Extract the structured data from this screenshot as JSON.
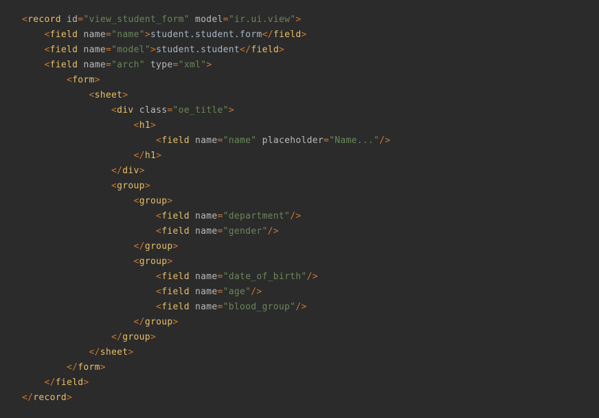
{
  "colors": {
    "bg": "#2b2b2b",
    "punct": "#cc7832",
    "tag": "#e8bf6a",
    "attr": "#bababa",
    "str": "#6a8759",
    "text": "#a9b7c6"
  },
  "indent_unit": 4,
  "tokens": {
    "lt": "<",
    "gt": ">",
    "lt_slash": "</",
    "slash_gt": "/>",
    "eq": "=",
    "q": "\""
  },
  "tags": {
    "record": "record",
    "field": "field",
    "form": "form",
    "sheet": "sheet",
    "div": "div",
    "h1": "h1",
    "group": "group"
  },
  "attrs": {
    "id": "id",
    "model": "model",
    "name": "name",
    "type": "type",
    "class": "class",
    "placeholder": "placeholder"
  },
  "vals": {
    "record_id": "view_student_form",
    "record_model": "ir.ui.view",
    "field_name_text": "student.student.form",
    "field_model_text": "student.student",
    "arch": "arch",
    "xml": "xml",
    "oe_title": "oe_title",
    "name": "name",
    "model": "model",
    "placeholder_name": "Name...",
    "department": "department",
    "gender": "gender",
    "date_of_birth": "date_of_birth",
    "age": "age",
    "blood_group": "blood_group"
  },
  "lines": [
    {
      "indent": 0,
      "parts": [
        {
          "t": "punct",
          "k": "tokens.lt"
        },
        {
          "t": "tag",
          "k": "tags.record"
        },
        {
          "t": "space"
        },
        {
          "t": "attr",
          "k": "attrs.id"
        },
        {
          "t": "punct",
          "k": "tokens.eq"
        },
        {
          "t": "q"
        },
        {
          "t": "str",
          "k": "vals.record_id"
        },
        {
          "t": "q"
        },
        {
          "t": "space"
        },
        {
          "t": "attr",
          "k": "attrs.model"
        },
        {
          "t": "punct",
          "k": "tokens.eq"
        },
        {
          "t": "q"
        },
        {
          "t": "str",
          "k": "vals.record_model"
        },
        {
          "t": "q"
        },
        {
          "t": "punct",
          "k": "tokens.gt"
        }
      ]
    },
    {
      "indent": 1,
      "parts": [
        {
          "t": "punct",
          "k": "tokens.lt"
        },
        {
          "t": "tag",
          "k": "tags.field"
        },
        {
          "t": "space"
        },
        {
          "t": "attr",
          "k": "attrs.name"
        },
        {
          "t": "punct",
          "k": "tokens.eq"
        },
        {
          "t": "q"
        },
        {
          "t": "str",
          "k": "vals.name"
        },
        {
          "t": "q"
        },
        {
          "t": "punct",
          "k": "tokens.gt"
        },
        {
          "t": "text",
          "k": "vals.field_name_text"
        },
        {
          "t": "punct",
          "k": "tokens.lt_slash"
        },
        {
          "t": "tag",
          "k": "tags.field"
        },
        {
          "t": "punct",
          "k": "tokens.gt"
        }
      ]
    },
    {
      "indent": 1,
      "parts": [
        {
          "t": "punct",
          "k": "tokens.lt"
        },
        {
          "t": "tag",
          "k": "tags.field"
        },
        {
          "t": "space"
        },
        {
          "t": "attr",
          "k": "attrs.name"
        },
        {
          "t": "punct",
          "k": "tokens.eq"
        },
        {
          "t": "q"
        },
        {
          "t": "str",
          "k": "vals.model"
        },
        {
          "t": "q"
        },
        {
          "t": "punct",
          "k": "tokens.gt"
        },
        {
          "t": "text",
          "k": "vals.field_model_text"
        },
        {
          "t": "punct",
          "k": "tokens.lt_slash"
        },
        {
          "t": "tag",
          "k": "tags.field"
        },
        {
          "t": "punct",
          "k": "tokens.gt"
        }
      ]
    },
    {
      "indent": 1,
      "parts": [
        {
          "t": "punct",
          "k": "tokens.lt"
        },
        {
          "t": "tag",
          "k": "tags.field"
        },
        {
          "t": "space"
        },
        {
          "t": "attr",
          "k": "attrs.name"
        },
        {
          "t": "punct",
          "k": "tokens.eq"
        },
        {
          "t": "q"
        },
        {
          "t": "str",
          "k": "vals.arch"
        },
        {
          "t": "q"
        },
        {
          "t": "space"
        },
        {
          "t": "attr",
          "k": "attrs.type"
        },
        {
          "t": "punct",
          "k": "tokens.eq"
        },
        {
          "t": "q"
        },
        {
          "t": "str",
          "k": "vals.xml"
        },
        {
          "t": "q"
        },
        {
          "t": "punct",
          "k": "tokens.gt"
        }
      ]
    },
    {
      "indent": 2,
      "parts": [
        {
          "t": "punct",
          "k": "tokens.lt"
        },
        {
          "t": "tag",
          "k": "tags.form"
        },
        {
          "t": "punct",
          "k": "tokens.gt"
        }
      ]
    },
    {
      "indent": 3,
      "parts": [
        {
          "t": "punct",
          "k": "tokens.lt"
        },
        {
          "t": "tag",
          "k": "tags.sheet"
        },
        {
          "t": "punct",
          "k": "tokens.gt"
        }
      ]
    },
    {
      "indent": 4,
      "parts": [
        {
          "t": "punct",
          "k": "tokens.lt"
        },
        {
          "t": "tag",
          "k": "tags.div"
        },
        {
          "t": "space"
        },
        {
          "t": "attr",
          "k": "attrs.class"
        },
        {
          "t": "punct",
          "k": "tokens.eq"
        },
        {
          "t": "q"
        },
        {
          "t": "str",
          "k": "vals.oe_title"
        },
        {
          "t": "q"
        },
        {
          "t": "punct",
          "k": "tokens.gt"
        }
      ]
    },
    {
      "indent": 5,
      "parts": [
        {
          "t": "punct",
          "k": "tokens.lt"
        },
        {
          "t": "tag",
          "k": "tags.h1"
        },
        {
          "t": "punct",
          "k": "tokens.gt"
        }
      ]
    },
    {
      "indent": 6,
      "parts": [
        {
          "t": "punct",
          "k": "tokens.lt"
        },
        {
          "t": "tag",
          "k": "tags.field"
        },
        {
          "t": "space"
        },
        {
          "t": "attr",
          "k": "attrs.name"
        },
        {
          "t": "punct",
          "k": "tokens.eq"
        },
        {
          "t": "q"
        },
        {
          "t": "str",
          "k": "vals.name"
        },
        {
          "t": "q"
        },
        {
          "t": "space"
        },
        {
          "t": "attr",
          "k": "attrs.placeholder"
        },
        {
          "t": "punct",
          "k": "tokens.eq"
        },
        {
          "t": "q"
        },
        {
          "t": "str",
          "k": "vals.placeholder_name"
        },
        {
          "t": "q"
        },
        {
          "t": "punct",
          "k": "tokens.slash_gt"
        }
      ]
    },
    {
      "indent": 5,
      "parts": [
        {
          "t": "punct",
          "k": "tokens.lt_slash"
        },
        {
          "t": "tag",
          "k": "tags.h1"
        },
        {
          "t": "punct",
          "k": "tokens.gt"
        }
      ]
    },
    {
      "indent": 4,
      "parts": [
        {
          "t": "punct",
          "k": "tokens.lt_slash"
        },
        {
          "t": "tag",
          "k": "tags.div"
        },
        {
          "t": "punct",
          "k": "tokens.gt"
        }
      ]
    },
    {
      "indent": 4,
      "parts": [
        {
          "t": "punct",
          "k": "tokens.lt"
        },
        {
          "t": "tag",
          "k": "tags.group"
        },
        {
          "t": "punct",
          "k": "tokens.gt"
        }
      ]
    },
    {
      "indent": 5,
      "parts": [
        {
          "t": "punct",
          "k": "tokens.lt"
        },
        {
          "t": "tag",
          "k": "tags.group"
        },
        {
          "t": "punct",
          "k": "tokens.gt"
        }
      ]
    },
    {
      "indent": 6,
      "parts": [
        {
          "t": "punct",
          "k": "tokens.lt"
        },
        {
          "t": "tag",
          "k": "tags.field"
        },
        {
          "t": "space"
        },
        {
          "t": "attr",
          "k": "attrs.name"
        },
        {
          "t": "punct",
          "k": "tokens.eq"
        },
        {
          "t": "q"
        },
        {
          "t": "str",
          "k": "vals.department"
        },
        {
          "t": "q"
        },
        {
          "t": "punct",
          "k": "tokens.slash_gt"
        }
      ]
    },
    {
      "indent": 6,
      "parts": [
        {
          "t": "punct",
          "k": "tokens.lt"
        },
        {
          "t": "tag",
          "k": "tags.field"
        },
        {
          "t": "space"
        },
        {
          "t": "attr",
          "k": "attrs.name"
        },
        {
          "t": "punct",
          "k": "tokens.eq"
        },
        {
          "t": "q"
        },
        {
          "t": "str",
          "k": "vals.gender"
        },
        {
          "t": "q"
        },
        {
          "t": "punct",
          "k": "tokens.slash_gt"
        }
      ]
    },
    {
      "indent": 5,
      "parts": [
        {
          "t": "punct",
          "k": "tokens.lt_slash"
        },
        {
          "t": "tag",
          "k": "tags.group"
        },
        {
          "t": "punct",
          "k": "tokens.gt"
        }
      ]
    },
    {
      "indent": 5,
      "parts": [
        {
          "t": "punct",
          "k": "tokens.lt"
        },
        {
          "t": "tag",
          "k": "tags.group"
        },
        {
          "t": "punct",
          "k": "tokens.gt"
        }
      ]
    },
    {
      "indent": 6,
      "parts": [
        {
          "t": "punct",
          "k": "tokens.lt"
        },
        {
          "t": "tag",
          "k": "tags.field"
        },
        {
          "t": "space"
        },
        {
          "t": "attr",
          "k": "attrs.name"
        },
        {
          "t": "punct",
          "k": "tokens.eq"
        },
        {
          "t": "q"
        },
        {
          "t": "str",
          "k": "vals.date_of_birth"
        },
        {
          "t": "q"
        },
        {
          "t": "punct",
          "k": "tokens.slash_gt"
        }
      ]
    },
    {
      "indent": 6,
      "parts": [
        {
          "t": "punct",
          "k": "tokens.lt"
        },
        {
          "t": "tag",
          "k": "tags.field"
        },
        {
          "t": "space"
        },
        {
          "t": "attr",
          "k": "attrs.name"
        },
        {
          "t": "punct",
          "k": "tokens.eq"
        },
        {
          "t": "q"
        },
        {
          "t": "str",
          "k": "vals.age"
        },
        {
          "t": "q"
        },
        {
          "t": "punct",
          "k": "tokens.slash_gt"
        }
      ]
    },
    {
      "indent": 6,
      "parts": [
        {
          "t": "punct",
          "k": "tokens.lt"
        },
        {
          "t": "tag",
          "k": "tags.field"
        },
        {
          "t": "space"
        },
        {
          "t": "attr",
          "k": "attrs.name"
        },
        {
          "t": "punct",
          "k": "tokens.eq"
        },
        {
          "t": "q"
        },
        {
          "t": "str",
          "k": "vals.blood_group"
        },
        {
          "t": "q"
        },
        {
          "t": "punct",
          "k": "tokens.slash_gt"
        }
      ]
    },
    {
      "indent": 5,
      "parts": [
        {
          "t": "punct",
          "k": "tokens.lt_slash"
        },
        {
          "t": "tag",
          "k": "tags.group"
        },
        {
          "t": "punct",
          "k": "tokens.gt"
        }
      ]
    },
    {
      "indent": 4,
      "parts": [
        {
          "t": "punct",
          "k": "tokens.lt_slash"
        },
        {
          "t": "tag",
          "k": "tags.group"
        },
        {
          "t": "punct",
          "k": "tokens.gt"
        }
      ]
    },
    {
      "indent": 3,
      "parts": [
        {
          "t": "punct",
          "k": "tokens.lt_slash"
        },
        {
          "t": "tag",
          "k": "tags.sheet"
        },
        {
          "t": "punct",
          "k": "tokens.gt"
        }
      ]
    },
    {
      "indent": 2,
      "parts": [
        {
          "t": "punct",
          "k": "tokens.lt_slash"
        },
        {
          "t": "tag",
          "k": "tags.form"
        },
        {
          "t": "punct",
          "k": "tokens.gt"
        }
      ]
    },
    {
      "indent": 1,
      "parts": [
        {
          "t": "punct",
          "k": "tokens.lt_slash"
        },
        {
          "t": "tag",
          "k": "tags.field"
        },
        {
          "t": "punct",
          "k": "tokens.gt"
        }
      ]
    },
    {
      "indent": 0,
      "parts": [
        {
          "t": "punct",
          "k": "tokens.lt_slash"
        },
        {
          "t": "tag",
          "k": "tags.record"
        },
        {
          "t": "punct",
          "k": "tokens.gt"
        }
      ]
    }
  ]
}
